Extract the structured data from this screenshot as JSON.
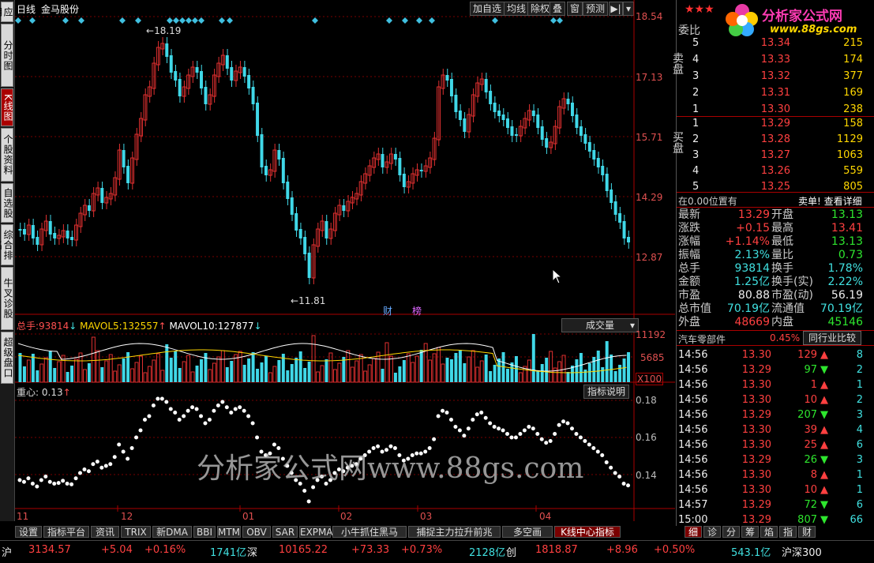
{
  "left_tabs": [
    {
      "label": "应用",
      "active": false
    },
    {
      "label": "分时图",
      "active": false
    },
    {
      "label": "K线图",
      "active": true
    },
    {
      "label": "个股资料",
      "active": false
    },
    {
      "label": "自选股",
      "active": false
    },
    {
      "label": "综合排名",
      "active": false
    },
    {
      "label": "牛叉诊股",
      "active": false
    },
    {
      "label": "超级盘口",
      "active": false
    }
  ],
  "header": {
    "period": "日线",
    "stock_name": "金马股份",
    "tools": [
      "加自选",
      "均线",
      "除权",
      "叠",
      "窗",
      "预测"
    ]
  },
  "price_axis": [
    "18.54",
    "17.13",
    "15.71",
    "14.29",
    "12.87"
  ],
  "price_annotations": {
    "high": "18.19",
    "low": "11.81",
    "event1": "财",
    "event2": "榜"
  },
  "volume_panel": {
    "label_total": "总手:",
    "total": "93814",
    "mavol5_label": "MAVOL5:",
    "mavol5": "132557",
    "mavol10_label": "MAVOL10:",
    "mavol10": "127877",
    "dropdown": "成交量",
    "axis": [
      "11192",
      "5685"
    ],
    "unit": "X100"
  },
  "indicator_panel": {
    "label": "重心:",
    "value": "0.13",
    "button": "指标说明",
    "axis": [
      "0.18",
      "0.16",
      "0.14"
    ]
  },
  "x_axis": [
    "11",
    "12",
    "01",
    "02",
    "03",
    "04"
  ],
  "watermark": "分析家公式网www.88gs.com",
  "bottom_tabs": [
    "设置",
    "指标平台",
    "资讯",
    "TRIX",
    "新DMA",
    "BBI",
    "MTM",
    "OBV",
    "SAR",
    "EXPMA",
    "小牛抓住黑马",
    "捕捉主力拉升前兆",
    "多空画",
    "K线中心指标"
  ],
  "logo": {
    "text": "分析家公式网",
    "url": "www.88gs.com"
  },
  "order_book": {
    "title": "委比",
    "sell_label": "卖盘",
    "buy_label": "买盘",
    "sell": [
      {
        "level": "5",
        "price": "13.34",
        "vol": "215"
      },
      {
        "level": "4",
        "price": "13.33",
        "vol": "174"
      },
      {
        "level": "3",
        "price": "13.32",
        "vol": "377"
      },
      {
        "level": "2",
        "price": "13.31",
        "vol": "169"
      },
      {
        "level": "1",
        "price": "13.30",
        "vol": "238"
      }
    ],
    "buy": [
      {
        "level": "1",
        "price": "13.29",
        "vol": "158"
      },
      {
        "level": "2",
        "price": "13.28",
        "vol": "1129"
      },
      {
        "level": "3",
        "price": "13.27",
        "vol": "1063"
      },
      {
        "level": "4",
        "price": "13.26",
        "vol": "559"
      },
      {
        "level": "5",
        "price": "13.25",
        "vol": "805"
      }
    ]
  },
  "position_line": {
    "left": "在0.00位置有",
    "right": "卖单! 查看详细"
  },
  "quote": [
    {
      "l1": "最新",
      "v1": "13.29",
      "c1": "red",
      "l2": "开盘",
      "v2": "13.13",
      "c2": "grn"
    },
    {
      "l1": "涨跌",
      "v1": "+0.15",
      "c1": "red",
      "l2": "最高",
      "v2": "13.41",
      "c2": "red"
    },
    {
      "l1": "涨幅",
      "v1": "+1.14%",
      "c1": "red",
      "l2": "最低",
      "v2": "13.13",
      "c2": "grn"
    },
    {
      "l1": "振幅",
      "v1": "2.13%",
      "c1": "cyan",
      "l2": "量比",
      "v2": "0.73",
      "c2": "grn"
    },
    {
      "l1": "总手",
      "v1": "93814",
      "c1": "cyan",
      "l2": "换手",
      "v2": "1.78%",
      "c2": "cyan"
    },
    {
      "l1": "金额",
      "v1": "1.25亿",
      "c1": "cyan",
      "l2": "换手(实)",
      "v2": "2.22%",
      "c2": "cyan"
    },
    {
      "l1": "市盈",
      "v1": "80.88",
      "c1": "wht",
      "l2": "市盈(动)",
      "v2": "56.19",
      "c2": "wht"
    },
    {
      "l1": "总市值",
      "v1": "70.19亿",
      "c1": "cyan",
      "l2": "流通值",
      "v2": "70.19亿",
      "c2": "cyan"
    },
    {
      "l1": "外盘",
      "v1": "48669",
      "c1": "red",
      "l2": "内盘",
      "v2": "45146",
      "c2": "grn"
    }
  ],
  "industry": {
    "name": "汽车零部件",
    "change": "0.45%",
    "button": "同行业比较"
  },
  "ticks": [
    {
      "t": "14:56",
      "p": "13.30",
      "v": "129",
      "d": "up",
      "n": "8"
    },
    {
      "t": "14:56",
      "p": "13.29",
      "v": "97",
      "d": "down",
      "n": "2"
    },
    {
      "t": "14:56",
      "p": "13.30",
      "v": "1",
      "d": "up",
      "n": "1"
    },
    {
      "t": "14:56",
      "p": "13.30",
      "v": "10",
      "d": "up",
      "n": "2"
    },
    {
      "t": "14:56",
      "p": "13.29",
      "v": "207",
      "d": "down",
      "n": "3"
    },
    {
      "t": "14:56",
      "p": "13.30",
      "v": "39",
      "d": "up",
      "n": "4"
    },
    {
      "t": "14:56",
      "p": "13.30",
      "v": "25",
      "d": "up",
      "n": "6"
    },
    {
      "t": "14:56",
      "p": "13.29",
      "v": "26",
      "d": "down",
      "n": "3"
    },
    {
      "t": "14:56",
      "p": "13.30",
      "v": "8",
      "d": "up",
      "n": "1"
    },
    {
      "t": "14:56",
      "p": "13.30",
      "v": "10",
      "d": "up",
      "n": "1"
    },
    {
      "t": "14:57",
      "p": "13.29",
      "v": "72",
      "d": "down",
      "n": "6"
    },
    {
      "t": "15:00",
      "p": "13.29",
      "v": "807",
      "d": "down",
      "n": "66"
    }
  ],
  "right_tabs": [
    "细",
    "诊",
    "分",
    "筹",
    "焰",
    "指",
    "财"
  ],
  "status_bar": {
    "sh_label": "沪",
    "sh_index": "3134.57",
    "sh_chg": "+5.04",
    "sh_pct": "+0.16%",
    "sh_amt": "1741亿",
    "sz_label": "深",
    "sz_index": "10165.22",
    "sz_chg": "+73.33",
    "sz_pct": "+0.73%",
    "sz_amt": "2128亿",
    "cy_label": "创",
    "cy_index": "1818.87",
    "cy_chg": "+8.96",
    "cy_pct": "+0.50%",
    "hs_amt": "543.1亿",
    "hs_label": "沪深300"
  }
}
